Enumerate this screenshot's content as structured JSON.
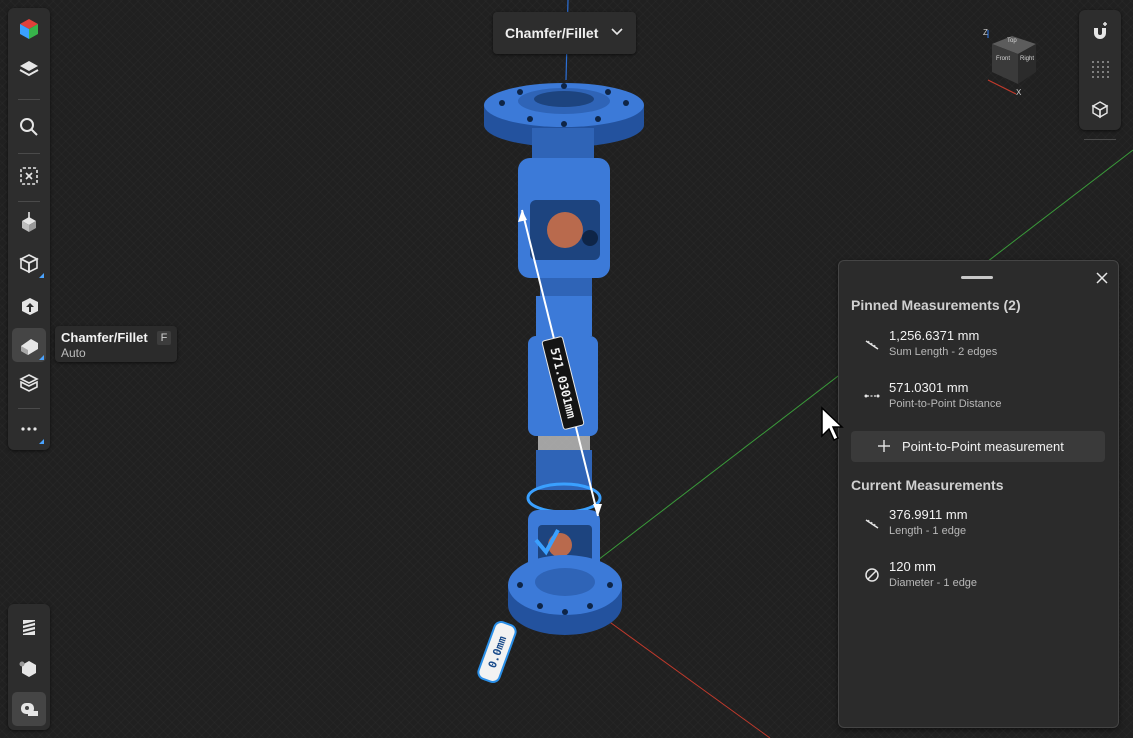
{
  "toolbar": {
    "items": [
      {
        "name": "cube-color-icon"
      },
      {
        "name": "layers-icon"
      },
      {
        "name": "search-icon"
      },
      {
        "name": "select-box-icon"
      },
      {
        "name": "move-icon"
      },
      {
        "name": "pull-icon"
      },
      {
        "name": "push-pull-icon"
      },
      {
        "name": "chamfer-fillet-icon"
      },
      {
        "name": "shell-icon"
      },
      {
        "name": "more-icon"
      }
    ],
    "bottom_items": [
      {
        "name": "stripes-icon"
      },
      {
        "name": "hexagon-icon"
      },
      {
        "name": "tape-measure-icon"
      }
    ]
  },
  "tooltip": {
    "title": "Chamfer/Fillet",
    "shortcut": "F",
    "subtitle": "Auto"
  },
  "mode_dropdown": {
    "label": "Chamfer/Fillet"
  },
  "viewcube": {
    "faces": [
      "Top",
      "Front",
      "Right"
    ],
    "axis_labels": [
      "Z",
      "X"
    ]
  },
  "dimensions": {
    "long": "571.0301mm",
    "short": "0.0mm"
  },
  "panel": {
    "pinned_title": "Pinned Measurements (2)",
    "pinned": [
      {
        "value": "1,256.6371 mm",
        "desc": "Sum Length - 2 edges",
        "icon": "length-icon"
      },
      {
        "value": "571.0301 mm",
        "desc": "Point-to-Point Distance",
        "icon": "point-distance-icon"
      }
    ],
    "add_button": "Point-to-Point measurement",
    "current_title": "Current Measurements",
    "current": [
      {
        "value": "376.9911 mm",
        "desc": "Length - 1 edge",
        "icon": "length-icon"
      },
      {
        "value": "120 mm",
        "desc": "Diameter - 1 edge",
        "icon": "diameter-icon"
      }
    ]
  },
  "colors": {
    "model": "#3c7ad8",
    "model_dark": "#23529e",
    "background": "#202020",
    "axis_x": "#c0392b",
    "axis_y": "#3a9a3a",
    "axis_z": "#2b6fd6"
  }
}
